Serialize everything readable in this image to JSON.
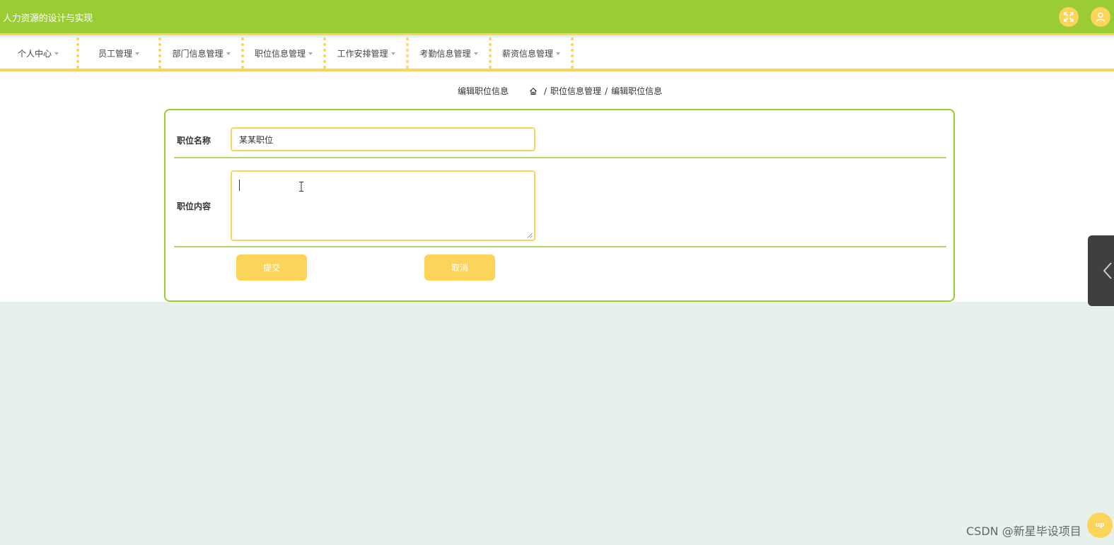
{
  "app": {
    "title": "人力资源的设计与实现"
  },
  "icons": {
    "fullscreen": "fullscreen-icon",
    "user": "user-icon",
    "home": "home-icon",
    "collapse": "chevron-left-icon"
  },
  "nav": {
    "items": [
      {
        "label": "个人中心"
      },
      {
        "label": "员工管理"
      },
      {
        "label": "部门信息管理"
      },
      {
        "label": "职位信息管理"
      },
      {
        "label": "工作安排管理"
      },
      {
        "label": "考勤信息管理"
      },
      {
        "label": "薪资信息管理"
      }
    ]
  },
  "page": {
    "heading": "编辑职位信息",
    "breadcrumb": {
      "parent": "职位信息管理",
      "current": "编辑职位信息",
      "separator": "/"
    }
  },
  "form": {
    "position_name_label": "职位名称",
    "position_name_value": "某某职位",
    "position_content_label": "职位内容",
    "position_content_value": "",
    "submit_label": "提交",
    "cancel_label": "取消"
  },
  "footer": {
    "watermark": "CSDN @新星毕设项目",
    "top_button_label": "up"
  },
  "colors": {
    "primary_green": "#9acd34",
    "accent_yellow": "#fcd45a",
    "background": "#e7f1ec"
  }
}
